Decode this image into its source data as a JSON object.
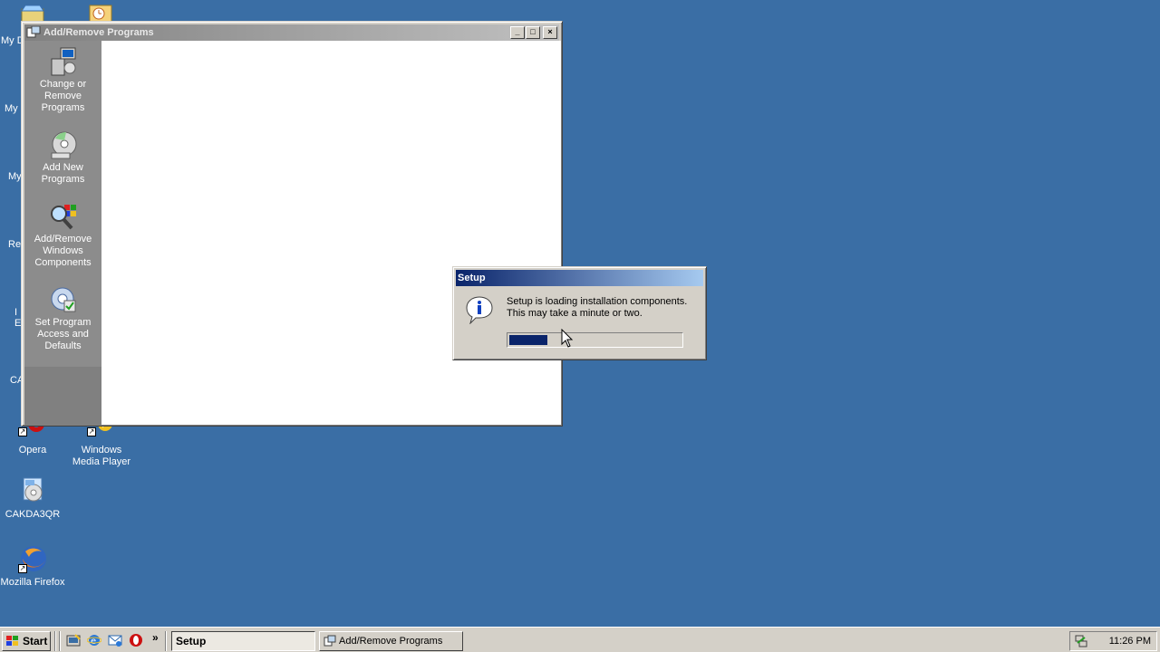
{
  "desktop": {
    "icons": [
      {
        "label": "Opera"
      },
      {
        "label": "Windows\nMedia Player"
      },
      {
        "label": "CAKDA3QR"
      },
      {
        "label": "Mozilla Firefox"
      }
    ],
    "fragments": [
      "My D",
      "My",
      "My",
      "Re",
      "I\nE",
      "CA"
    ]
  },
  "arp_window": {
    "title": "Add/Remove Programs",
    "buttons": {
      "minimize": "_",
      "maximize": "□",
      "close": "×"
    },
    "sidebar": [
      {
        "label": "Change or Remove Programs",
        "icon": "change-remove-programs-icon"
      },
      {
        "label": "Add New Programs",
        "icon": "add-new-programs-icon"
      },
      {
        "label": "Add/Remove Windows Components",
        "icon": "windows-components-icon"
      },
      {
        "label": "Set Program Access and Defaults",
        "icon": "program-access-icon"
      }
    ]
  },
  "setup_dialog": {
    "title": "Setup",
    "message_line1": "Setup is loading installation components.",
    "message_line2": "This may take a minute or two.",
    "progress": 0.22
  },
  "taskbar": {
    "start_label": "Start",
    "more_label": "»",
    "tasks": [
      {
        "label": "Setup",
        "active": true
      },
      {
        "label": "Add/Remove Programs",
        "active": false
      }
    ],
    "clock": "11:26 PM"
  },
  "colors": {
    "desktop": "#3a6ea5",
    "active_title_start": "#0a246a",
    "active_title_end": "#a6caf0",
    "inactive_title_start": "#808080",
    "inactive_title_end": "#c0c0c0",
    "face": "#d4d0c8"
  }
}
